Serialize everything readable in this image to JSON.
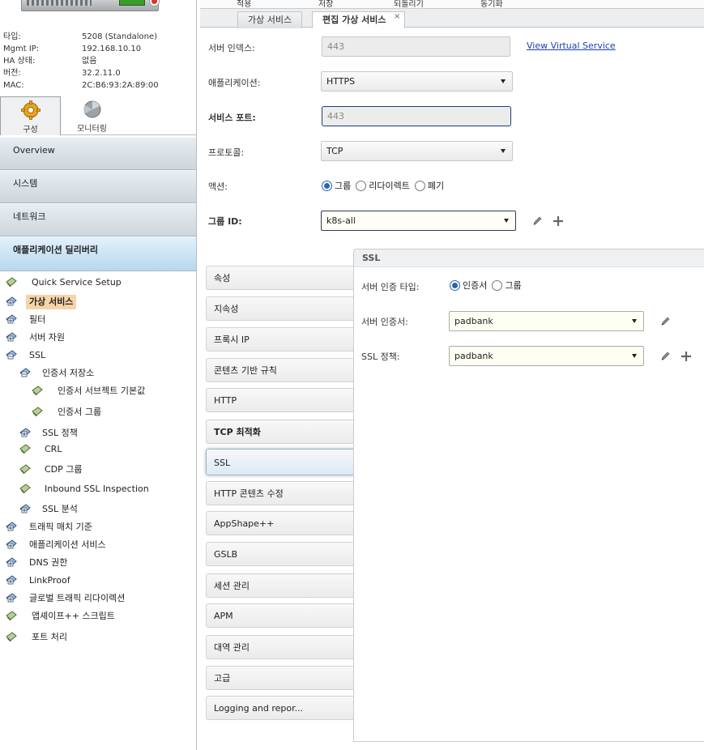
{
  "device": {
    "info": [
      {
        "key": "타입:",
        "value": "5208 (Standalone)"
      },
      {
        "key": "Mgmt IP:",
        "value": "192.168.10.10"
      },
      {
        "key": "HA 상태:",
        "value": "없음"
      },
      {
        "key": "버전:",
        "value": "32.2.11.0"
      },
      {
        "key": "MAC:",
        "value": "2C:B6:93:2A:89:00"
      }
    ]
  },
  "mode_tabs": [
    {
      "label": "구성",
      "icon": "gear-icon",
      "active": true
    },
    {
      "label": "모니터링",
      "icon": "monitor-icon",
      "active": false
    }
  ],
  "accordion": [
    {
      "label": "Overview"
    },
    {
      "label": "시스템"
    },
    {
      "label": "네트워크"
    },
    {
      "label": "애플리케이션 딜리버리"
    }
  ],
  "tree": [
    {
      "label": "Quick Service Setup"
    },
    {
      "label": "가상 서비스",
      "selected": true
    },
    {
      "label": "필터"
    },
    {
      "label": "서버 자원"
    },
    {
      "label": "SSL"
    },
    {
      "label": "인증서 저장소"
    },
    {
      "label": "인증서 서브젝트 기본값"
    },
    {
      "label": "인증서 그룹"
    },
    {
      "label": "SSL 정책"
    },
    {
      "label": "CRL"
    },
    {
      "label": "CDP 그룹"
    },
    {
      "label": "Inbound SSL Inspection"
    },
    {
      "label": "SSL 분석"
    },
    {
      "label": "트래픽 매치 기준"
    },
    {
      "label": "애플리케이션 서비스"
    },
    {
      "label": "DNS 권한"
    },
    {
      "label": "LinkProof"
    },
    {
      "label": "글로벌 트래픽 리다이렉션"
    },
    {
      "label": "앱셰이프++ 스크립트"
    },
    {
      "label": "포트 처리"
    }
  ],
  "toolbar": {
    "apply": "적용",
    "save": "저장",
    "revert": "되돌리기",
    "sync": "동기화"
  },
  "tabs": {
    "virtual_services": "가상 서비스",
    "edit_virtual_service": "편집 가상 서비스",
    "close": "×"
  },
  "form": {
    "server_index_label": "서버 인덱스:",
    "server_index_value": "443",
    "view_link": "View Virtual Service",
    "application_label": "애플리케이션:",
    "application_value": "HTTPS",
    "service_port_label": "서비스 포트:",
    "service_port_value": "443",
    "protocol_label": "프로토콜:",
    "protocol_value": "TCP",
    "action_label": "액션:",
    "action_options": [
      "그룹",
      "리다이렉트",
      "폐기"
    ],
    "action_selected": "그룹",
    "group_id_label": "그룹 ID:",
    "group_id_value": "k8s-all"
  },
  "side_nav": [
    {
      "label": "속성"
    },
    {
      "label": "지속성"
    },
    {
      "label": "프록시 IP"
    },
    {
      "label": "콘텐츠 기반 규칙"
    },
    {
      "label": "HTTP"
    },
    {
      "label": "TCP 최적화"
    },
    {
      "label": "SSL",
      "active": true
    },
    {
      "label": "HTTP 콘텐츠 수정"
    },
    {
      "label": "AppShape++"
    },
    {
      "label": "GSLB"
    },
    {
      "label": "세션 관리"
    },
    {
      "label": "APM"
    },
    {
      "label": "대역 관리"
    },
    {
      "label": "고급"
    },
    {
      "label": "Logging and repor..."
    }
  ],
  "ssl": {
    "title": "SSL",
    "auth_type_label": "서버 인증 타입:",
    "auth_type_options": [
      "인증서",
      "그룹"
    ],
    "auth_type_selected": "인증서",
    "cert_label": "서버 인증서:",
    "cert_value": "padbank",
    "policy_label": "SSL 정책:",
    "policy_value": "padbank"
  },
  "colors": {
    "accent_blue": "#2a64b0",
    "selected_tree": "#f7d4a8",
    "open_accordion": "#b6d8ee",
    "link": "#1a3fb3"
  }
}
